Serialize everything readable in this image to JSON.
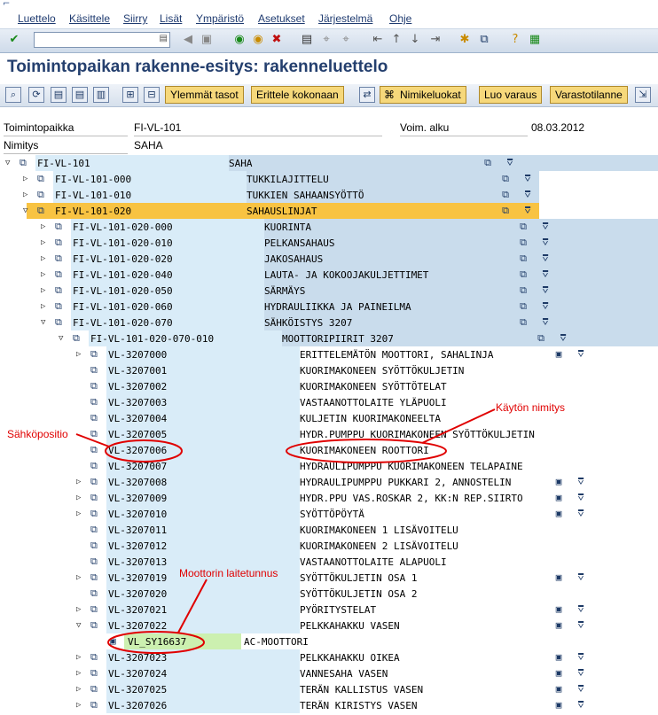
{
  "menu": [
    "Luettelo",
    "Käsittele",
    "Siirry",
    "Lisät",
    "Ympäristö",
    "Asetukset",
    "Järjestelmä",
    "Ohje"
  ],
  "title": "Toimintopaikan rakenne-esitys: rakenneluettelo",
  "toolbar2_buttons": [
    "Ylemmät tasot",
    "Erittele kokonaan",
    "Nimikeluokat",
    "Luo varaus",
    "Varastotilanne"
  ],
  "header": {
    "toimintopaikka_label": "Toimintopaikka",
    "toimintopaikka_value": "FI-VL-101",
    "voim_label": "Voim. alku",
    "voim_value": "08.03.2012",
    "nimitys_label": "Nimitys",
    "nimitys_value": "SAHA"
  },
  "rows": [
    {
      "code": "FI-VL-101",
      "desc": "SAHA",
      "level": 0,
      "exp": "open",
      "icon": "floc-icon",
      "right": "floc"
    },
    {
      "code": "FI-VL-101-000",
      "desc": "TUKKILAJITTELU",
      "level": 1,
      "exp": "closed",
      "icon": "floc-icon",
      "right": "floc"
    },
    {
      "code": "FI-VL-101-010",
      "desc": "TUKKIEN SAHAANSYÖTTÖ",
      "level": 1,
      "exp": "closed",
      "icon": "floc-icon",
      "right": "floc"
    },
    {
      "code": "FI-VL-101-020",
      "desc": "SAHAUSLINJAT",
      "level": 1,
      "exp": "open",
      "icon": "floc-icon",
      "right": "floc",
      "selected": true
    },
    {
      "code": "FI-VL-101-020-000",
      "desc": "KUORINTA",
      "level": 2,
      "exp": "closed",
      "icon": "floc-icon",
      "right": "floc"
    },
    {
      "code": "FI-VL-101-020-010",
      "desc": "PELKANSAHAUS",
      "level": 2,
      "exp": "closed",
      "icon": "floc-icon",
      "right": "floc"
    },
    {
      "code": "FI-VL-101-020-020",
      "desc": "JAKOSAHAUS",
      "level": 2,
      "exp": "closed",
      "icon": "floc-icon",
      "right": "floc"
    },
    {
      "code": "FI-VL-101-020-040",
      "desc": "LAUTA- JA KOKOOJAKULJETTIMET",
      "level": 2,
      "exp": "closed",
      "icon": "floc-icon",
      "right": "floc"
    },
    {
      "code": "FI-VL-101-020-050",
      "desc": "SÄRMÄYS",
      "level": 2,
      "exp": "closed",
      "icon": "floc-icon",
      "right": "floc"
    },
    {
      "code": "FI-VL-101-020-060",
      "desc": "HYDRAULIIKKA JA PAINEILMA",
      "level": 2,
      "exp": "closed",
      "icon": "floc-icon",
      "right": "floc"
    },
    {
      "code": "FI-VL-101-020-070",
      "desc": "SÄHKÖISTYS 3207",
      "level": 2,
      "exp": "open",
      "icon": "floc-icon",
      "right": "floc"
    },
    {
      "code": "FI-VL-101-020-070-010",
      "desc": "MOOTTORIPIIRIT 3207",
      "level": 3,
      "exp": "open",
      "icon": "floc-icon",
      "right": "floc"
    },
    {
      "code": "VL-3207000",
      "desc": "ERITTELEMÄTÖN MOOTTORI, SAHALINJA",
      "level": 4,
      "exp": "closed",
      "icon": "floc-icon",
      "right": "equip"
    },
    {
      "code": "VL-3207001",
      "desc": "KUORIMAKONEEN SYÖTTÖKULJETIN",
      "level": 4,
      "exp": "none",
      "icon": "floc-icon",
      "right": "none"
    },
    {
      "code": "VL-3207002",
      "desc": "KUORIMAKONEEN SYÖTTÖTELAT",
      "level": 4,
      "exp": "none",
      "icon": "floc-icon",
      "right": "none"
    },
    {
      "code": "VL-3207003",
      "desc": "VASTAANOTTOLAITE YLÄPUOLI",
      "level": 4,
      "exp": "none",
      "icon": "floc-icon",
      "right": "none"
    },
    {
      "code": "VL-3207004",
      "desc": "KULJETIN KUORIMAKONEELTA",
      "level": 4,
      "exp": "none",
      "icon": "floc-icon",
      "right": "none"
    },
    {
      "code": "VL-3207005",
      "desc": "HYDR.PUMPPU KUORIMAKONEEN SYÖTTÖKULJETIN",
      "level": 4,
      "exp": "none",
      "icon": "floc-icon",
      "right": "none"
    },
    {
      "code": "VL-3207006",
      "desc": "KUORIMAKONEEN ROOTTORI",
      "level": 4,
      "exp": "none",
      "icon": "floc-icon",
      "right": "none"
    },
    {
      "code": "VL-3207007",
      "desc": "HYDRAULIPUMPPU KUORIMAKONEEN TELAPAINE",
      "level": 4,
      "exp": "none",
      "icon": "floc-icon",
      "right": "none"
    },
    {
      "code": "VL-3207008",
      "desc": "HYDRAULIPUMPPU PUKKARI 2, ANNOSTELIN",
      "level": 4,
      "exp": "closed",
      "icon": "floc-icon",
      "right": "equip"
    },
    {
      "code": "VL-3207009",
      "desc": "HYDR.PPU VAS.ROSKAR 2, KK:N REP.SIIRTO",
      "level": 4,
      "exp": "closed",
      "icon": "floc-icon",
      "right": "equip"
    },
    {
      "code": "VL-3207010",
      "desc": "SYÖTTÖPÖYTÄ",
      "level": 4,
      "exp": "closed",
      "icon": "floc-icon",
      "right": "equip"
    },
    {
      "code": "VL-3207011",
      "desc": "KUORIMAKONEEN 1 LISÄVOITELU",
      "level": 4,
      "exp": "none",
      "icon": "floc-icon",
      "right": "none"
    },
    {
      "code": "VL-3207012",
      "desc": "KUORIMAKONEEN 2 LISÄVOITELU",
      "level": 4,
      "exp": "none",
      "icon": "floc-icon",
      "right": "none"
    },
    {
      "code": "VL-3207013",
      "desc": "VASTAANOTTOLAITE ALAPUOLI",
      "level": 4,
      "exp": "none",
      "icon": "floc-icon",
      "right": "none"
    },
    {
      "code": "VL-3207019",
      "desc": "SYÖTTÖKULJETIN OSA 1",
      "level": 4,
      "exp": "closed",
      "icon": "floc-icon",
      "right": "equip"
    },
    {
      "code": "VL-3207020",
      "desc": "SYÖTTÖKULJETIN OSA 2",
      "level": 4,
      "exp": "none",
      "icon": "floc-icon",
      "right": "none"
    },
    {
      "code": "VL-3207021",
      "desc": "PYÖRITYSTELAT",
      "level": 4,
      "exp": "closed",
      "icon": "floc-icon",
      "right": "equip"
    },
    {
      "code": "VL-3207022",
      "desc": "PELKKAHAKKU VASEN",
      "level": 4,
      "exp": "open",
      "icon": "floc-icon",
      "right": "equip"
    },
    {
      "code": "VL_SY16637",
      "desc": "AC-MOOTTORI",
      "level": 5,
      "exp": "none",
      "icon": "equip-icon",
      "right": "none",
      "equipment": true
    },
    {
      "code": "VL-3207023",
      "desc": "PELKKAHAKKU OIKEA",
      "level": 4,
      "exp": "closed",
      "icon": "floc-icon",
      "right": "equip"
    },
    {
      "code": "VL-3207024",
      "desc": "VANNESAHA VASEN",
      "level": 4,
      "exp": "closed",
      "icon": "floc-icon",
      "right": "equip"
    },
    {
      "code": "VL-3207025",
      "desc": "TERÄN KALLISTUS VASEN",
      "level": 4,
      "exp": "closed",
      "icon": "floc-icon",
      "right": "equip"
    },
    {
      "code": "VL-3207026",
      "desc": "TERÄN KIRISTYS VASEN",
      "level": 4,
      "exp": "closed",
      "icon": "floc-icon",
      "right": "equip"
    }
  ],
  "annotations": {
    "sahkopositio": "Sähköpositio",
    "kayton_nimitys": "Käytön nimitys",
    "moottorin_laitetunnus": "Moottorin laitetunnus"
  },
  "colors": {
    "selected": "#f8c342",
    "band_light": "#d9ecf8",
    "band_green": "#ccf0b0",
    "title": "#243f6e",
    "annotation": "#e00000"
  }
}
